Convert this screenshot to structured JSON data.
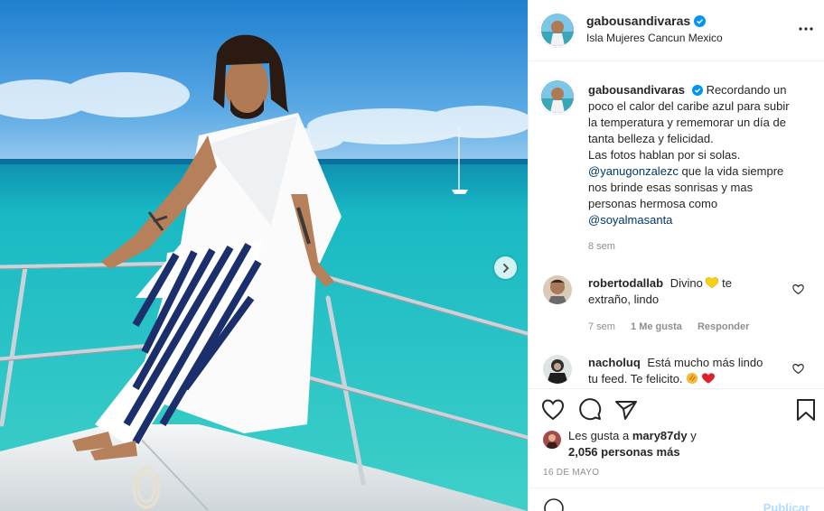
{
  "post": {
    "username": "gabousandivaras",
    "location": "Isla Mujeres Cancun Mexico",
    "caption_lines": [
      "Recordando un",
      "poco el calor del caribe azul para subir",
      "la temperatura y rememorar un día de",
      "tanta belleza y felicidad.",
      "Las fotos hablan por si solas."
    ],
    "mention1": "@yanugonzalezc",
    "after_mention1": " que la vida siempre",
    "line_after_1": "nos brinde esas sonrisas y mas",
    "line_after_2": "personas hermosa como",
    "mention2": "@soyalmasanta",
    "caption_time": "8 sem"
  },
  "comments": [
    {
      "username": "robertodallab",
      "text_before": "Divino",
      "emoji1": "yellow-heart",
      "text_after": "te",
      "text_line2": "extraño, lindo",
      "time": "7 sem",
      "likes": "1 Me gusta",
      "reply": "Responder"
    },
    {
      "username": "nacholuq",
      "text_line1": "Está mucho más lindo",
      "text_line2": "tu feed. Te felicito."
    }
  ],
  "likes": {
    "prefix": "Les gusta a",
    "user": "mary87dy",
    "conj": "y",
    "count": "2,056 personas más"
  },
  "date": "16 DE MAYO",
  "add_comment": {
    "post_label": "Publicar"
  },
  "colors": {
    "link": "#00376b",
    "muted": "#8e8e8e",
    "verified": "#0095f6",
    "sea": "#19c0c6",
    "sky": "#2f8fd6"
  }
}
